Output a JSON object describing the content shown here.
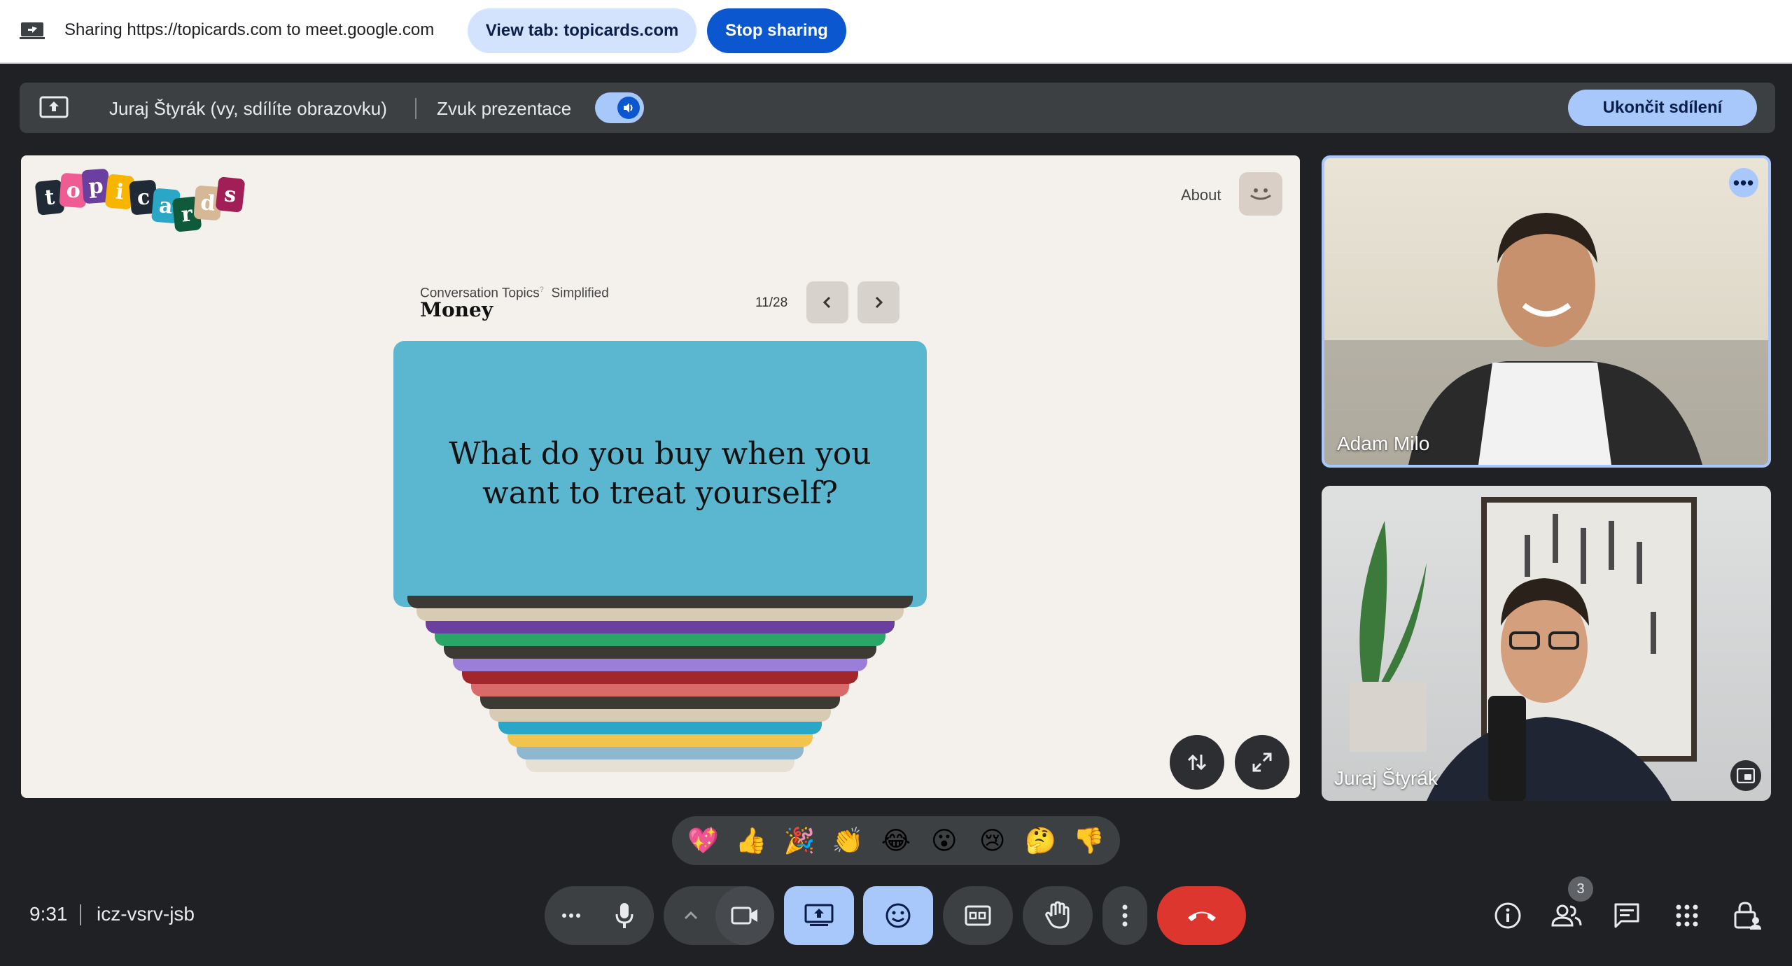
{
  "sharebar": {
    "text": "Sharing https://topicards.com to meet.google.com",
    "view_tab_label": "View tab: topicards.com",
    "stop_label": "Stop sharing"
  },
  "presentation_bar": {
    "presenter": "Juraj Štyrák (vy, sdílíte obrazovku)",
    "audio_label": "Zvuk prezentace",
    "audio_enabled": true,
    "end_share_label": "Ukončit sdílení"
  },
  "shared_tab": {
    "logo_letters": [
      "t",
      "o",
      "p",
      "i",
      "c",
      "a",
      "r",
      "d",
      "s"
    ],
    "logo_colors": [
      "#1f2a36",
      "#ef5b93",
      "#6b3fa0",
      "#f7b500",
      "#1f2a36",
      "#2aa6c6",
      "#0e5a3a",
      "#d6b796",
      "#a11f56"
    ],
    "about_label": "About",
    "category": "Conversation Topics",
    "category_mark": "?",
    "mode": "Simplified",
    "title": "Money",
    "pager": "11/28",
    "question": "What do you buy when you want to treat yourself?",
    "card_color": "#5bb7cf",
    "stack_colors": [
      "#3d3a33",
      "#d8cbb3",
      "#6b3fa0",
      "#2ba669",
      "#3d3a33",
      "#9b7ed8",
      "#a3262b",
      "#d96a6a",
      "#3d3a33",
      "#d8cbb3",
      "#2aa6c6",
      "#f0c44f",
      "#8fb8cf",
      "#e6dfd3"
    ]
  },
  "participants": [
    {
      "name": "Adam Milo"
    },
    {
      "name": "Juraj Štyrák"
    }
  ],
  "reactions": [
    "💖",
    "👍",
    "🎉",
    "👏",
    "😂",
    "😮",
    "😢",
    "🤔",
    "👎"
  ],
  "footer": {
    "time": "9:31",
    "meeting_code": "icz-vsrv-jsb",
    "participant_count": "3"
  },
  "colors": {
    "accent": "#0b57d0",
    "accent_light": "#a8c7fa",
    "hangup": "#dc362e",
    "background": "#202124"
  }
}
